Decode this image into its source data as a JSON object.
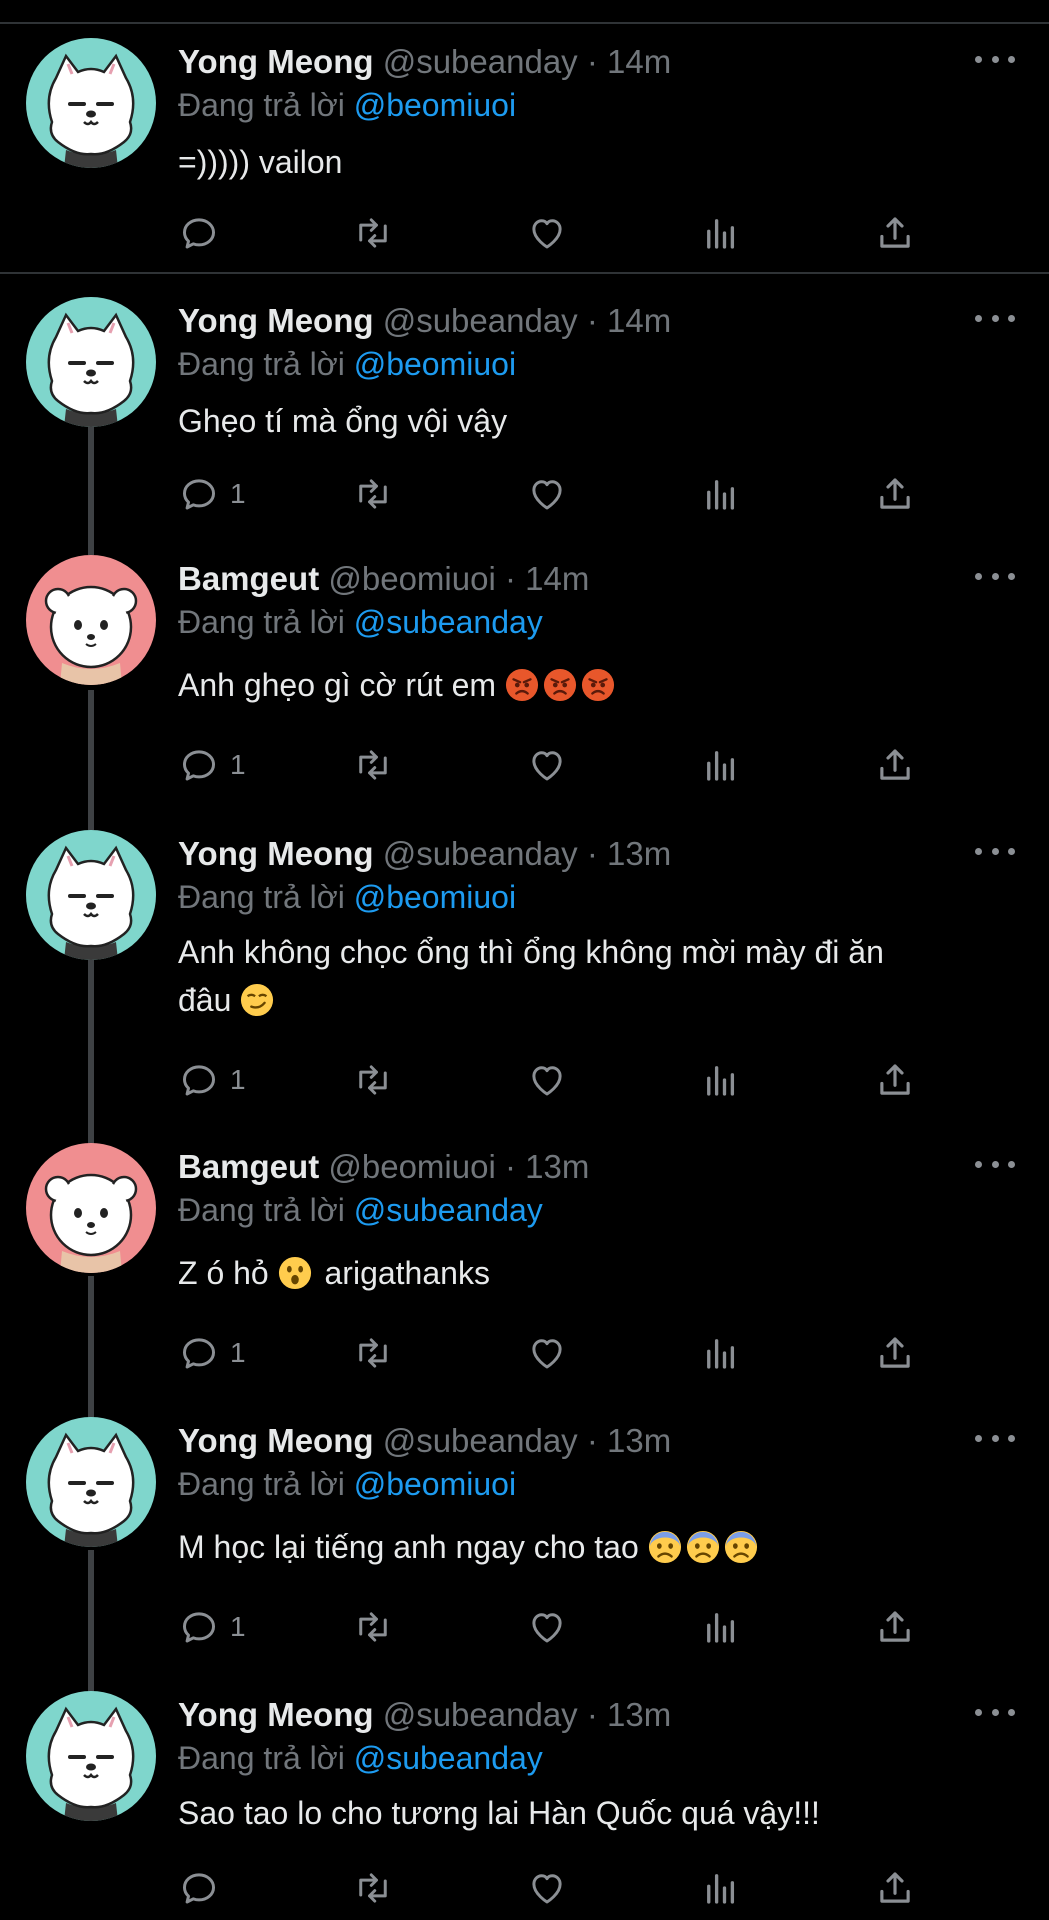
{
  "colors": {
    "accent": "#1d9bf0",
    "muted": "#71767b",
    "text": "#e7e9ea",
    "bg": "#000000",
    "teal": "#7fd6cc",
    "pink": "#f08e90"
  },
  "reply_prefix": "Đang trả lời",
  "tweets": [
    {
      "name": "Yong Meong",
      "handle": "@subeanday",
      "time": "14m",
      "reply_to": "@beomiuoi",
      "text": "=))))) vailon",
      "reply_count": "",
      "avatar": "yong"
    },
    {
      "name": "Yong Meong",
      "handle": "@subeanday",
      "time": "14m",
      "reply_to": "@beomiuoi",
      "text": "Ghẹo tí mà ổng vội vậy",
      "reply_count": "1",
      "avatar": "yong"
    },
    {
      "name": "Bamgeut",
      "handle": "@beomiuoi",
      "time": "14m",
      "reply_to": "@subeanday",
      "text": "Anh ghẹo gì cờ rút em",
      "emojis": [
        "angry-face",
        "angry-face",
        "angry-face"
      ],
      "reply_count": "1",
      "avatar": "bam"
    },
    {
      "name": "Yong Meong",
      "handle": "@subeanday",
      "time": "13m",
      "reply_to": "@beomiuoi",
      "text_line1": "Anh không chọc ổng thì ổng không mời mày đi ăn",
      "text_line2": "đâu",
      "emojis": [
        "smirk-face"
      ],
      "reply_count": "1",
      "avatar": "yong"
    },
    {
      "name": "Bamgeut",
      "handle": "@beomiuoi",
      "time": "13m",
      "reply_to": "@subeanday",
      "text_before": "Z ó hỏ",
      "text_after": "arigathanks",
      "emojis": [
        "surprised-face"
      ],
      "reply_count": "1",
      "avatar": "bam"
    },
    {
      "name": "Yong Meong",
      "handle": "@subeanday",
      "time": "13m",
      "reply_to": "@beomiuoi",
      "text": "M học lại tiếng anh ngay cho tao",
      "emojis": [
        "fearful-face",
        "fearful-face",
        "fearful-face"
      ],
      "reply_count": "1",
      "avatar": "yong"
    },
    {
      "name": "Yong Meong",
      "handle": "@subeanday",
      "time": "13m",
      "reply_to": "@subeanday",
      "text": "Sao tao lo cho tương lai Hàn Quốc quá vậy!!!",
      "reply_count": "",
      "avatar": "yong"
    }
  ],
  "icons": {
    "reply": "reply-icon",
    "retweet": "retweet-icon",
    "like": "heart-icon",
    "views": "views-icon",
    "share": "share-icon",
    "more": "more-icon"
  }
}
